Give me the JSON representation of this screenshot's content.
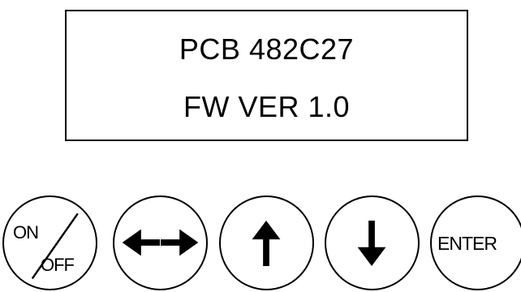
{
  "display": {
    "line1": "PCB 482C27",
    "line2": "FW VER 1.0"
  },
  "buttons": {
    "onoff": {
      "on": "ON",
      "off": "OFF",
      "icon": "slash-divider"
    },
    "leftright": {
      "icon": "left-right-arrow-icon"
    },
    "up": {
      "icon": "up-arrow-icon"
    },
    "down": {
      "icon": "down-arrow-icon"
    },
    "enter": {
      "label": "ENTER"
    }
  },
  "colors": {
    "stroke": "#000000",
    "background": "#ffffff"
  }
}
